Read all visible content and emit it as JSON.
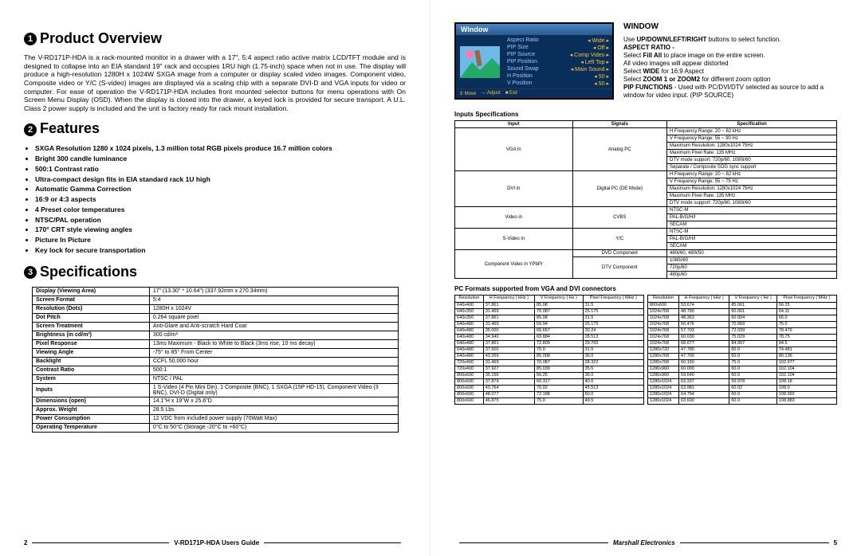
{
  "left": {
    "s1_title": "Product Overview",
    "overview": "The V-RD171P-HDA is a rack-mounted monitor in a drawer with a 17\", 5:4 aspect ratio active matrix LCD/TFT module and is designed to collapse into an EIA standard 19\" rack and occupies 1RU high (1.75-inch) space when not in use. The display will produce a high-resolution 1280H x 1024W SXGA image from a computer or display scaled video images. Component video, Composite video or Y/C (S-video) images are displayed via a scaling chip with a separate DVI-D and VGA inputs for video or computer. For ease of operation the V-RD171P-HDA includes front mounted selector buttons for menu operations with On Screen Menu Display (OSD). When the display is closed into the drawer, a keyed lock is provided for secure transport. A U.L. Class 2 power supply is included and the unit is factory ready for rack mount installation.",
    "s2_title": "Features",
    "features": [
      "SXGA Resolution 1280 x 1024 pixels, 1.3 million total RGB pixels produce 16.7 million colors",
      "Bright 300 candle luminance",
      "500:1 Contrast ratio",
      "Ultra-compact design fits in EIA standard rack 1U high",
      "Automatic Gamma Correction",
      "16:9 or 4:3 aspects",
      "4 Preset color temperatures",
      "NTSC/PAL operation",
      "170° CRT style viewing angles",
      "Picture In Picture",
      "Key lock for secure transportation"
    ],
    "s3_title": "Specifications",
    "specs": [
      [
        "Display (Viewing Area)",
        "17\" (13.30\" * 10.64\") (337.92mm x 270.34mm)"
      ],
      [
        "Screen Format",
        "5:4"
      ],
      [
        "Resolution (Dots)",
        "1280H x 1024V"
      ],
      [
        "Dot Pitch",
        "0.264 square pixel"
      ],
      [
        "Screen Treatment",
        "Anti-Glare and Anti-scratch Hard Coat"
      ],
      [
        "Brightness (in cd/m²)",
        "300 cd/m²"
      ],
      [
        "Pixel Response",
        "13ms Maximum - Black to White to Black (3ms rise, 10 ms decay)"
      ],
      [
        "Viewing Angle",
        "-75° to 85° From Center"
      ],
      [
        "Backlight",
        "CCFL 50,000 hour"
      ],
      [
        "Contrast Ratio",
        "500:1"
      ],
      [
        "System",
        "NTSC / PAL"
      ],
      [
        "Inputs",
        "1 S-Video (4 Pin Mini Din), 1 Composite (BNC), 1 SXGA (15P HD-15), Component Video (3 BNC), DVI-D (Digital only)"
      ],
      [
        "Dimensions (open)",
        "14.1\"H x 19\"W x 25.6\"D"
      ],
      [
        "Approx. Weight",
        "28.5 Lbs"
      ],
      [
        "Power Consumption",
        "12 VDC from included power supply (70Watt Max)"
      ],
      [
        "Operating Temperature",
        "0°C to 50°C (Storage -20°C to +60°C)"
      ]
    ],
    "page_num": "2",
    "footer_title": "V-RD171P-HDA Users Guide"
  },
  "right": {
    "osd_title": "Window",
    "osd_rows": [
      [
        "Aspect Ratio",
        "Wide"
      ],
      [
        "PIP Size",
        "Off"
      ],
      [
        "PIP Source",
        "Comp Video"
      ],
      [
        "PIP Position",
        "Left Top"
      ],
      [
        "Sound Swap",
        "Main Sound"
      ],
      [
        "H Position",
        "50"
      ],
      [
        "V Position",
        "50"
      ]
    ],
    "osd_foot": [
      "⇕:Move",
      "⇔:Adjust",
      "■:Exit"
    ],
    "window_heading": "WINDOW",
    "window_body_1a": "Use ",
    "window_body_1b": "UP/DOWN/LEFT/RIGHT",
    "window_body_1c": " buttons to select function.",
    "window_line_ar": "ASPECT RATIO -",
    "window_line_2a": "All video images will appear distorted",
    "window_line_fill_a": "Select ",
    "window_line_fill_b": "Fill All",
    "window_line_fill_c": " to place image on the entire screen.",
    "window_line_wide_a": "Select ",
    "window_line_wide_b": "WIDE",
    "window_line_wide_c": " for 16:9 Aspect",
    "window_line_zoom_a": "Select ",
    "window_line_zoom_b": "ZOOM 1 or ZOOM2",
    "window_line_zoom_c": " for different zoom option",
    "window_line_pip_a": "PIP FUNCTIONS",
    "window_line_pip_b": " - Used with PC/DVI/DTV selected as source to add a window for video input. (PIP SOURCE)",
    "inputs_title": "Inputs Specifications",
    "inputs_header": [
      "Input",
      "Signals",
      "Specification"
    ],
    "inputs_rows": [
      {
        "input": "VGA in",
        "irs": 6,
        "signal": "Analog PC",
        "srs": 6,
        "spec": "H Frequency Range: 20 ~ 82 kHz"
      },
      {
        "spec": "V Frequency Range: 55 ~ 90 Hz"
      },
      {
        "spec": "Maximum Resolution: 1280x1024 75Hz"
      },
      {
        "spec": "Maximum Pixel Rate: 135 MHz"
      },
      {
        "spec": "DTV mode support: 720p/60, 1080i/60"
      },
      {
        "spec": "Separate / Composite SOG sync support"
      },
      {
        "input": "DVI in",
        "irs": 5,
        "signal": "Digital PC (DE Mode)",
        "srs": 5,
        "spec": "H Frequency Range: 20 ~ 82 kHz"
      },
      {
        "spec": "V Frequency Range: 55 ~ 75 Hz"
      },
      {
        "spec": "Maximum Resolution: 1280x1024 75Hz"
      },
      {
        "spec": "Maximum Pixel Rate: 135 MHz"
      },
      {
        "spec": "DTV mode support: 720p/60, 1080i/60"
      },
      {
        "input": "Video in",
        "irs": 3,
        "signal": "CVBS",
        "srs": 3,
        "spec": "NTSC-M"
      },
      {
        "spec": "PAL-B/G/H/I"
      },
      {
        "spec": "SECAM"
      },
      {
        "input": "S-Video in",
        "irs": 3,
        "signal": "Y/C",
        "srs": 3,
        "spec": "NTSC-M"
      },
      {
        "spec": "PAL-B/G/H/I"
      },
      {
        "spec": "SECAM"
      },
      {
        "input": "Component Video in YPbPr",
        "irs": 4,
        "signal": "DVD Component",
        "srs": 1,
        "spec": "480i/60, 480i/50"
      },
      {
        "signal": "DTV Component",
        "srs": 3,
        "spec": "1080i/60"
      },
      {
        "spec": "720p/60"
      },
      {
        "spec": "480p/60"
      }
    ],
    "pc_title": "PC Formats supported from VGA and DVI connectors",
    "pc_header": [
      "Resolution",
      "H Frequency ( kHz )",
      "V Frequency ( Hz )",
      "Pixel Frequency ( MHz )"
    ],
    "pc_left": [
      [
        "640x400",
        "37.861",
        "85.08",
        "31.5"
      ],
      [
        "640x350",
        "31.469",
        "70.087",
        "25.175"
      ],
      [
        "640x350",
        "37.861",
        "85.08",
        "31.5"
      ],
      [
        "640x480",
        "31.469",
        "59.94",
        "25.175"
      ],
      [
        "640x480",
        "35.000",
        "66.667",
        "30.24"
      ],
      [
        "640x480",
        "34.940",
        "69.884",
        "28.513"
      ],
      [
        "640x480",
        "37.861",
        "72.809",
        "29.765"
      ],
      [
        "640x480",
        "37.500",
        "75.0",
        "31.5"
      ],
      [
        "640x480",
        "43.269",
        "85.008",
        "36.0"
      ],
      [
        "720x400",
        "31.469",
        "70.087",
        "28.322"
      ],
      [
        "720x400",
        "37.927",
        "85.039",
        "35.5"
      ],
      [
        "800x600",
        "35.156",
        "56.25",
        "36.0"
      ],
      [
        "800x600",
        "37.879",
        "60.317",
        "40.0"
      ],
      [
        "800x600",
        "43.764",
        "70.02",
        "45.513"
      ],
      [
        "800x600",
        "48.077",
        "72.188",
        "50.0"
      ],
      [
        "800x600",
        "46.875",
        "75.0",
        "49.5"
      ]
    ],
    "pc_right": [
      [
        "800x600",
        "53.674",
        "85.061",
        "56.25"
      ],
      [
        "1024x768",
        "48.780",
        "60.001",
        "64.11"
      ],
      [
        "1024x768",
        "48.363",
        "60.004",
        "65.0"
      ],
      [
        "1024x768",
        "56.476",
        "70.069",
        "75.0"
      ],
      [
        "1024x768",
        "57.703",
        "72.039",
        "78.476"
      ],
      [
        "1024x768",
        "60.030",
        "75.029",
        "78.75"
      ],
      [
        "1024x768",
        "68.677",
        "84.997",
        "94.5"
      ],
      [
        "1280x720",
        "47.780",
        "60.0",
        "74.481"
      ],
      [
        "1280x768",
        "47.700",
        "60.0",
        "80.136"
      ],
      [
        "1280x768",
        "60.150",
        "75.0",
        "102.977"
      ],
      [
        "1280x960",
        "60.000",
        "60.0",
        "102.104"
      ],
      [
        "1280x960",
        "59.640",
        "60.0",
        "102.104"
      ],
      [
        "1280x1024",
        "63.337",
        "59.978",
        "108.18"
      ],
      [
        "1280x1024",
        "63.981",
        "60.02",
        "108.0"
      ],
      [
        "1280x1024",
        "64.754",
        "60.0",
        "108.992"
      ],
      [
        "1280x1024",
        "63.600",
        "60.0",
        "108.883"
      ]
    ],
    "page_num": "5",
    "footer_title": "Marshall Electronics"
  }
}
